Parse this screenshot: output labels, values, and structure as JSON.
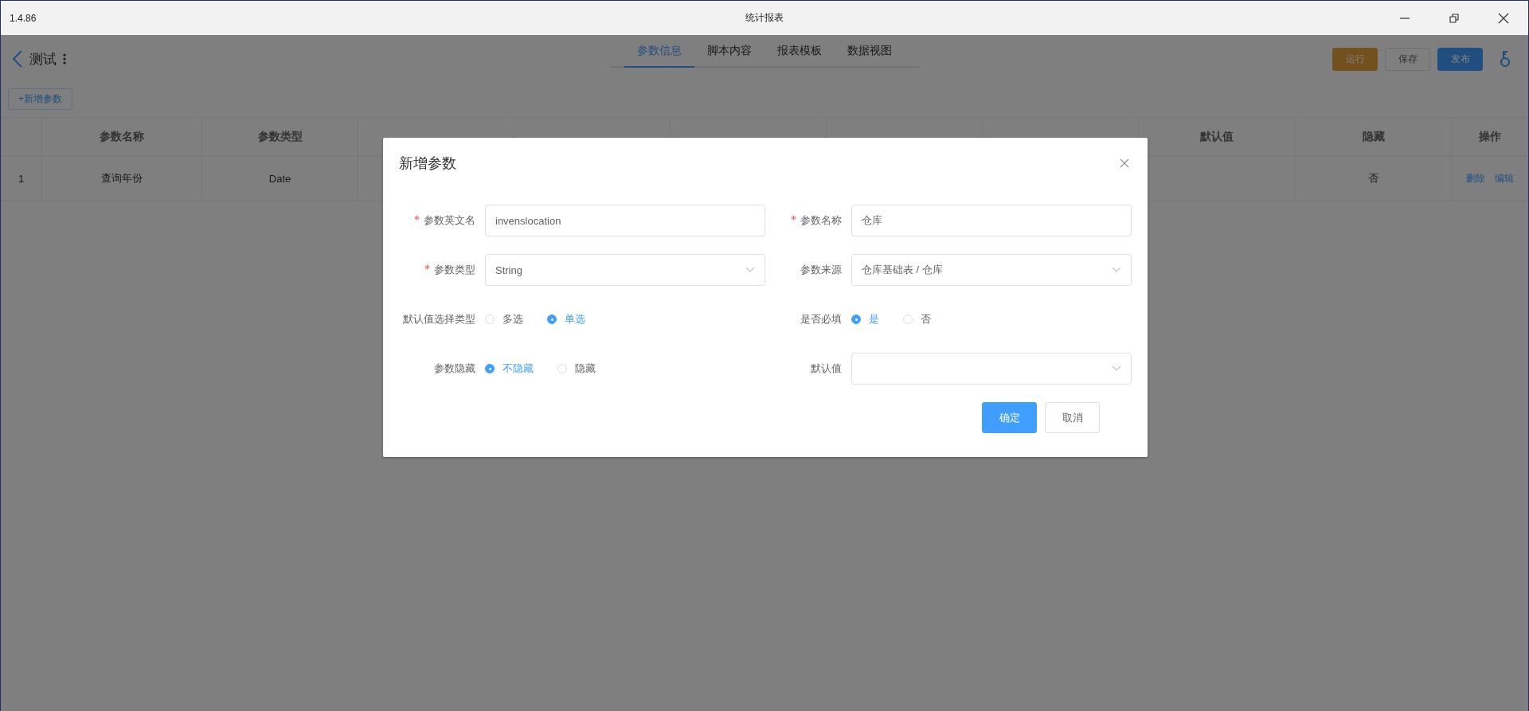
{
  "window": {
    "version": "1.4.86",
    "title": "统计报表"
  },
  "header": {
    "title": "测试",
    "tabs": [
      {
        "label": "参数信息",
        "selected": true
      },
      {
        "label": "脚本内容",
        "selected": false
      },
      {
        "label": "报表模板",
        "selected": false
      },
      {
        "label": "数据视图",
        "selected": false
      }
    ],
    "buttons": [
      {
        "label": "运行",
        "kind": "warning"
      },
      {
        "label": "保存",
        "kind": "default"
      },
      {
        "label": "发布",
        "kind": "primary"
      }
    ]
  },
  "toolbar": {
    "add_button": "+新增参数"
  },
  "table": {
    "columns": [
      {
        "kind": "label",
        "label": "参数名称"
      },
      {
        "kind": "label",
        "label": "参数类型"
      },
      {
        "kind": "covered"
      },
      {
        "kind": "covered"
      },
      {
        "kind": "covered"
      },
      {
        "kind": "covered"
      },
      {
        "kind": "covered"
      },
      {
        "kind": "label",
        "label": "默认值"
      },
      {
        "kind": "label",
        "label": "隐藏"
      },
      {
        "kind": "label",
        "label": "操作"
      }
    ],
    "rows": [
      {
        "index": "1",
        "name": "查询年份",
        "type": "Date",
        "hidden": "否",
        "actions": [
          "删除",
          "编辑"
        ]
      }
    ]
  },
  "dialog": {
    "title": "新增参数",
    "fields": [
      {
        "kind": "input",
        "label": "参数英文名",
        "required": true,
        "value": "invenslocation"
      },
      {
        "kind": "input",
        "label": "参数名称",
        "required": true,
        "value": "仓库"
      },
      {
        "kind": "select",
        "label": "参数类型",
        "required": true,
        "value": "String"
      },
      {
        "kind": "select",
        "label": "参数来源",
        "required": false,
        "value": "仓库基础表 / 仓库"
      },
      {
        "kind": "radio",
        "label": "默认值选择类型",
        "required": false,
        "options": [
          {
            "label": "多选",
            "selected": false
          },
          {
            "label": "单选",
            "selected": true
          }
        ]
      },
      {
        "kind": "radio",
        "label": "是否必填",
        "required": false,
        "options": [
          {
            "label": "是",
            "selected": true
          },
          {
            "label": "否",
            "selected": false
          }
        ]
      },
      {
        "kind": "radio",
        "label": "参数隐藏",
        "required": false,
        "options": [
          {
            "label": "不隐藏",
            "selected": true
          },
          {
            "label": "隐藏",
            "selected": false
          }
        ]
      },
      {
        "kind": "select",
        "label": "默认值",
        "required": false
      }
    ],
    "buttons": [
      {
        "label": "确定",
        "kind": "primary"
      },
      {
        "label": "取消",
        "kind": "default"
      }
    ]
  }
}
